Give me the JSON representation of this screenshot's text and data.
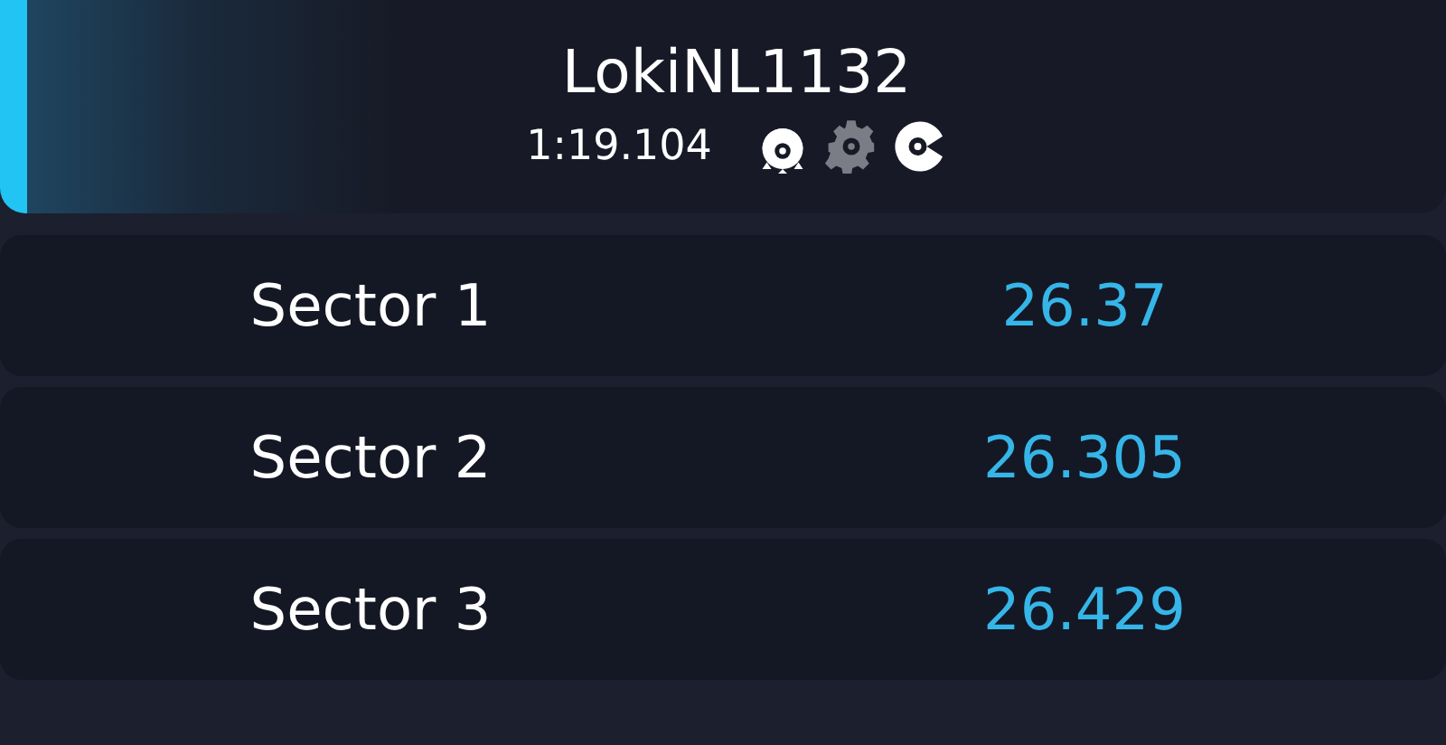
{
  "driver": {
    "name": "LokiNL1132",
    "lap_time": "1:19.104",
    "highlighted": true,
    "assists": [
      {
        "kind": "tire",
        "on": true
      },
      {
        "kind": "gear",
        "on": false
      },
      {
        "kind": "disc",
        "on": true
      }
    ]
  },
  "sectors": [
    {
      "label": "Sector 1",
      "time": "26.37"
    },
    {
      "label": "Sector 2",
      "time": "26.305"
    },
    {
      "label": "Sector 3",
      "time": "26.429"
    }
  ]
}
